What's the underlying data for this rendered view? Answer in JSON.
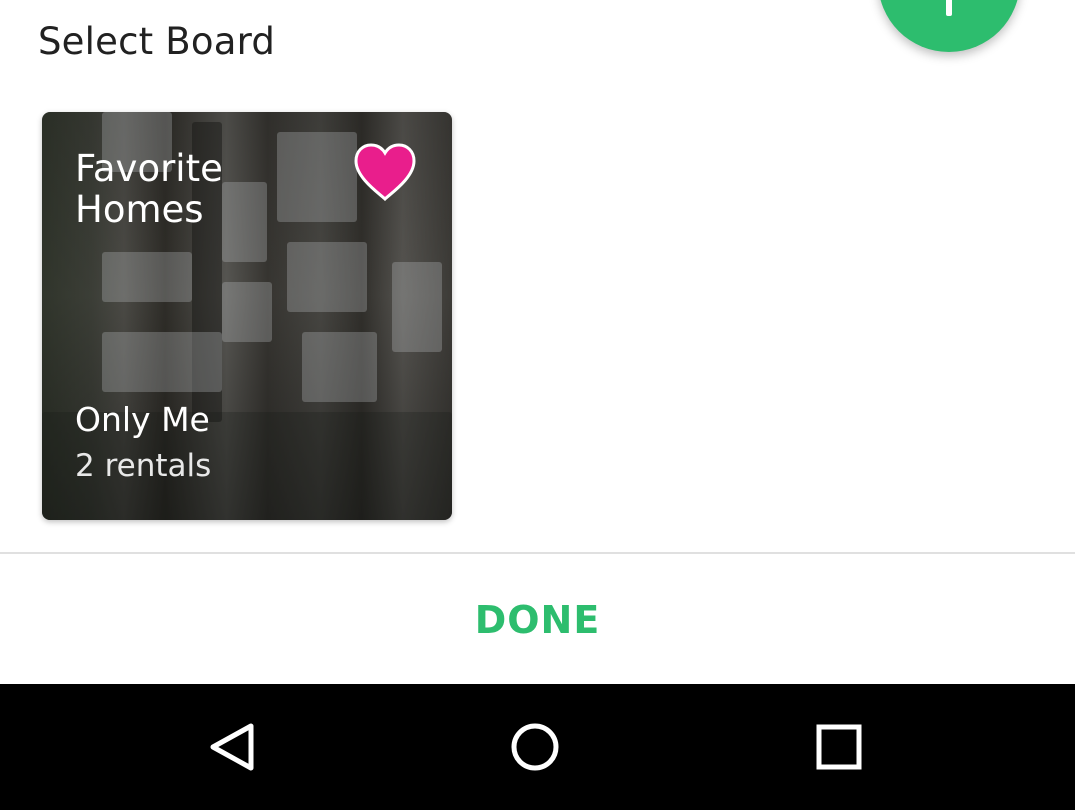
{
  "sheet": {
    "title": "Select Board"
  },
  "board": {
    "name": "Favorite\nHomes",
    "privacy": "Only Me",
    "count": "2 rentals",
    "favorite_icon": "heart-icon",
    "favorite_color": "#e91e8c"
  },
  "actions": {
    "done_label": "DONE"
  },
  "colors": {
    "accent": "#2dbd6e",
    "title_text": "#212121",
    "nav_bar": "#000000"
  },
  "navigation": {
    "back_icon": "back-triangle-icon",
    "home_icon": "home-circle-icon",
    "recents_icon": "recents-square-icon"
  }
}
